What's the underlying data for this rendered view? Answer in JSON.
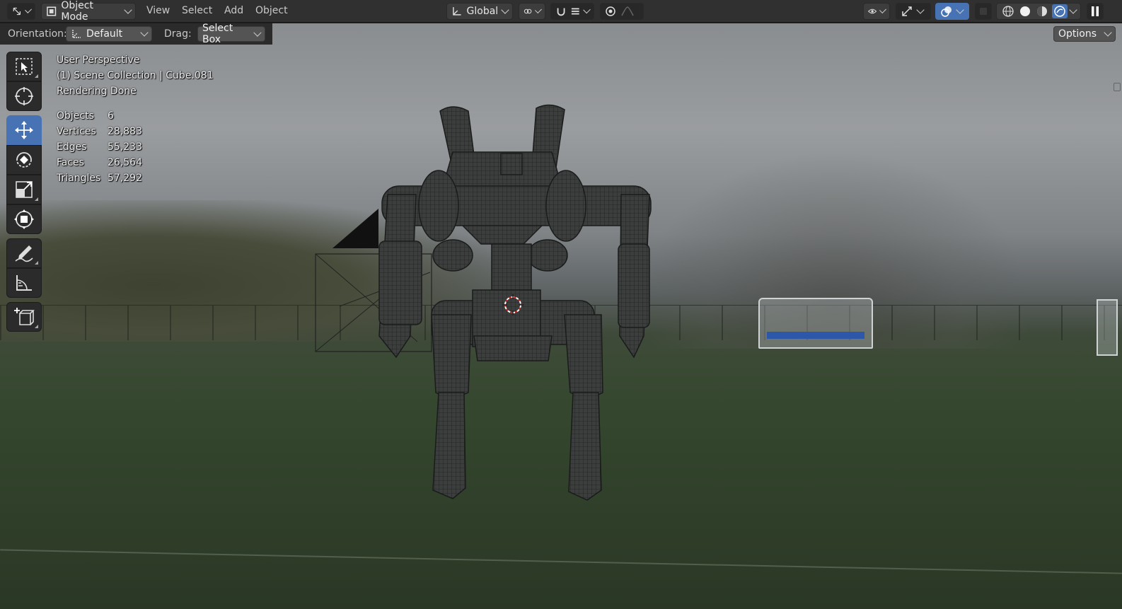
{
  "header": {
    "mode_selector": "Object Mode",
    "menus": [
      "View",
      "Select",
      "Add",
      "Object"
    ],
    "transform_orientation": "Global"
  },
  "tool_settings": {
    "orientation_label": "Orientation:",
    "orientation_value": "Default",
    "drag_label": "Drag:",
    "drag_value": "Select Box",
    "options_label": "Options"
  },
  "viewport": {
    "perspective": "User Perspective",
    "collection": "(1) Scene Collection | Cube.081",
    "status": "Rendering Done",
    "stats": [
      {
        "label": "Objects",
        "value": "6"
      },
      {
        "label": "Vertices",
        "value": "28,883"
      },
      {
        "label": "Edges",
        "value": "55,233"
      },
      {
        "label": "Faces",
        "value": "26,564"
      },
      {
        "label": "Triangles",
        "value": "57,292"
      }
    ]
  },
  "tools": [
    {
      "icon": "select-box-icon",
      "active": false
    },
    {
      "icon": "cursor-icon",
      "active": false
    },
    {
      "icon": "move-icon",
      "active": true
    },
    {
      "icon": "rotate-icon",
      "active": false
    },
    {
      "icon": "scale-icon",
      "active": false
    },
    {
      "icon": "transform-icon",
      "active": false
    },
    {
      "icon": "annotate-icon",
      "active": false
    },
    {
      "icon": "measure-icon",
      "active": false
    },
    {
      "icon": "add-cube-icon",
      "active": false
    }
  ],
  "colors": {
    "active_tool": "#4772b3",
    "header_bg": "#303030",
    "accent_blue": "#4772b3"
  }
}
